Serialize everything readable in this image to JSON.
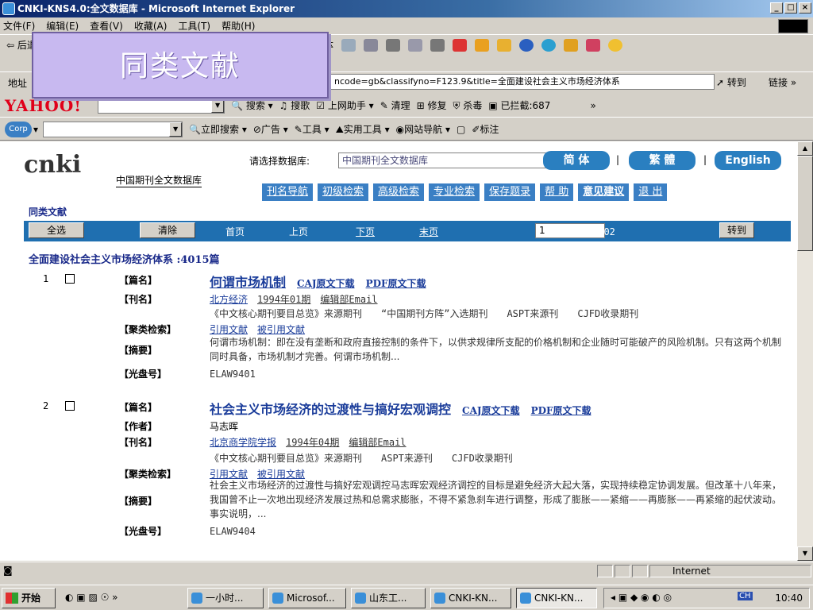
{
  "window": {
    "title": "CNKI-KNS4.0:全文数据库 - Microsoft Internet Explorer",
    "controls": [
      "_",
      "□",
      "×"
    ]
  },
  "menu": [
    "文件(F)",
    "编辑(E)",
    "查看(V)",
    "收藏(A)",
    "工具(T)",
    "帮助(H)"
  ],
  "callout": "同类文献",
  "toolbar": {
    "back": "后退",
    "font": "媒体"
  },
  "address": {
    "label": "地址",
    "url": "ncode=gb&classifyno=F123.9&title=全面建设社会主义市场经济体系",
    "go": "转到",
    "links": "链接 »"
  },
  "yahoo": {
    "logo": "YAHOO!",
    "search": "搜索",
    "song": "搜歌",
    "helper": "上网助手",
    "clean": "清理",
    "repair": "修复",
    "virus": "杀毒",
    "blocked": "已拦截:687"
  },
  "corp": {
    "logo": "Corp",
    "search": "立即搜索",
    "ad": "广告",
    "tools": "工具",
    "util": "实用工具",
    "nav": "网站导航",
    "mark": "标注"
  },
  "cnki": {
    "logo": "cnki",
    "subtitle": "中国期刊全文数据库",
    "db_label": "请选择数据库:",
    "db_value": "中国期刊全文数据库",
    "simp": "简 体",
    "trad": "繁 體",
    "eng": "English",
    "nav": [
      "刊名导航",
      "初级检索",
      "高级检索",
      "专业检索",
      "保存题录",
      "帮 助",
      "意见建议",
      "退 出"
    ]
  },
  "page": {
    "section": "同类文献",
    "selall": "全选",
    "clear": "清除",
    "first": "首页",
    "prev": "上页",
    "next": "下页",
    "last": "末页",
    "pageno": "1",
    "total": "/402",
    "go": "转到",
    "heading": "全面建设社会主义市场经济体系 :4015篇"
  },
  "records": [
    {
      "num": "1",
      "labels": {
        "title": "【篇名】",
        "journal": "【刊名】",
        "cluster": "【聚类检索】",
        "abstract": "【摘要】",
        "cd": "【光盘号】"
      },
      "title": "何谓市场机制",
      "caj": "CAJ原文下载",
      "pdf": "PDF原文下载",
      "journal": "北方经济",
      "issue": "1994年01期",
      "editor": "编辑部Email",
      "sources": "《中文核心期刊要目总览》来源期刊　　“中国期刊方阵”入选期刊　　ASPT来源刊　　CJFD收录期刊",
      "cite": "引用文献",
      "cited": "被引用文献",
      "abstract": "何谓市场机制：即在没有垄断和政府直接控制的条件下，以供求规律所支配的价格机制和企业随时可能破产的风险机制。只有这两个机制同时具备，市场机制才完善。何谓市场机制...",
      "cd": "ELAW9401"
    },
    {
      "num": "2",
      "labels": {
        "title": "【篇名】",
        "author": "【作者】",
        "journal": "【刊名】",
        "cluster": "【聚类检索】",
        "abstract": "【摘要】",
        "cd": "【光盘号】"
      },
      "title": "社会主义市场经济的过渡性与搞好宏观调控",
      "caj": "CAJ原文下载",
      "pdf": "PDF原文下载",
      "author": "马志晖",
      "journal": "北京商学院学报",
      "issue": "1994年04期",
      "editor": "编辑部Email",
      "sources": "《中文核心期刊要目总览》来源期刊　　ASPT来源刊　　CJFD收录期刊",
      "cite": "引用文献",
      "cited": "被引用文献",
      "abstract": "社会主义市场经济的过渡性与搞好宏观调控马志晖宏观经济调控的目标是避免经济大起大落，实现持续稳定协调发展。但改革十八年来，我国曾不止一次地出现经济发展过热和总需求膨胀，不得不紧急刹车进行调整，形成了膨胀——紧缩——再膨胀——再紧缩的起伏波动。事实说明，...",
      "cd": "ELAW9404"
    }
  ],
  "status": {
    "zone": "Internet"
  },
  "taskbar": {
    "start": "开始",
    "tasks": [
      "一小时...",
      "Microsof...",
      "山东工...",
      "CNKI-KN...",
      "CNKI-KN..."
    ],
    "clock": "10:40",
    "ime": "CH"
  }
}
